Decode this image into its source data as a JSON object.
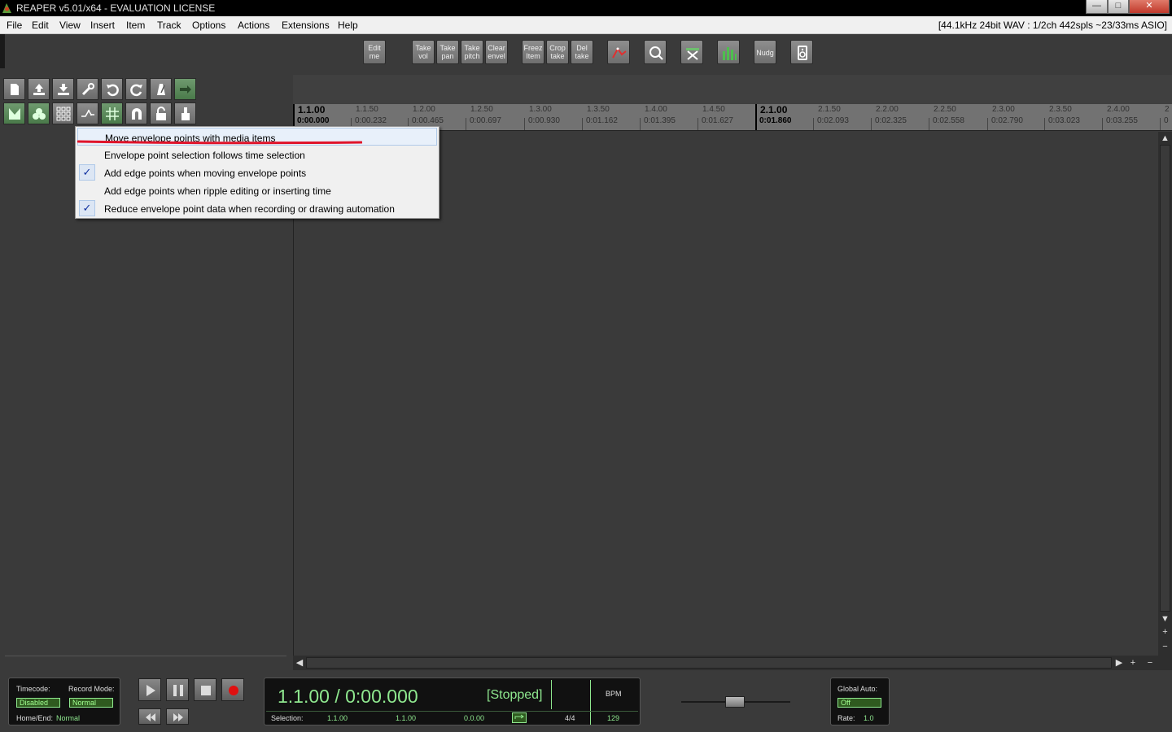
{
  "window": {
    "title": "REAPER v5.01/x64 - EVALUATION LICENSE",
    "controls": {
      "minimize": "—",
      "maximize": "□",
      "close": "✕"
    }
  },
  "menubar": {
    "items": [
      "File",
      "Edit",
      "View",
      "Insert",
      "Item",
      "Track",
      "Options",
      "Actions",
      "Extensions",
      "Help"
    ],
    "status": "[44.1kHz 24bit WAV : 1/2ch 442spls ~23/33ms ASIO]"
  },
  "toolbar": {
    "edit_mode": [
      "Edit",
      "me"
    ],
    "take_vol": [
      "Take",
      "vol"
    ],
    "take_pan": [
      "Take",
      "pan"
    ],
    "take_pitch": [
      "Take",
      "pitch"
    ],
    "clear_envel": [
      "Clear",
      "envel"
    ],
    "freeze_item": [
      "Freez",
      "Item"
    ],
    "crop_take": [
      "Crop",
      "take"
    ],
    "del_take": [
      "Del",
      "take"
    ],
    "nudge": "Nudg"
  },
  "ruler": {
    "marks": [
      {
        "beat": "1.1.00",
        "time": "0:00.000",
        "major": true
      },
      {
        "beat": "1.1.50",
        "time": "0:00.232"
      },
      {
        "beat": "1.2.00",
        "time": "0:00.465"
      },
      {
        "beat": "1.2.50",
        "time": "0:00.697"
      },
      {
        "beat": "1.3.00",
        "time": "0:00.930"
      },
      {
        "beat": "1.3.50",
        "time": "0:01.162"
      },
      {
        "beat": "1.4.00",
        "time": "0:01.395"
      },
      {
        "beat": "1.4.50",
        "time": "0:01.627"
      },
      {
        "beat": "2.1.00",
        "time": "0:01.860",
        "major": true
      },
      {
        "beat": "2.1.50",
        "time": "0:02.093"
      },
      {
        "beat": "2.2.00",
        "time": "0:02.325"
      },
      {
        "beat": "2.2.50",
        "time": "0:02.558"
      },
      {
        "beat": "2.3.00",
        "time": "0:02.790"
      },
      {
        "beat": "2.3.50",
        "time": "0:03.023"
      },
      {
        "beat": "2.4.00",
        "time": "0:03.255"
      },
      {
        "beat": "2",
        "time": "0"
      }
    ]
  },
  "context_menu": {
    "items": [
      {
        "label": "Move envelope points with media items",
        "checked": false,
        "highlighted": true
      },
      {
        "label": "Envelope point selection follows time selection",
        "checked": false
      },
      {
        "label": "Add edge points when moving envelope points",
        "checked": true
      },
      {
        "label": "Add edge points when ripple editing or inserting time",
        "checked": false
      },
      {
        "label": "Reduce envelope point data when recording or drawing automation",
        "checked": true
      }
    ],
    "check_glyph": "✓"
  },
  "transport": {
    "timecode_label": "Timecode:",
    "timecode_value": "Disabled",
    "record_mode_label": "Record Mode:",
    "record_mode_value": "Normal",
    "home_end_label": "Home/End:",
    "home_end_value": "Normal",
    "position": "1.1.00 / 0:00.000",
    "state": "[Stopped]",
    "bpm_label": "BPM",
    "selection_label": "Selection:",
    "sel_start": "1.1.00",
    "sel_end": "1.1.00",
    "sel_length": "0.0.00",
    "time_sig": "4/4",
    "bpm_value": "129",
    "global_auto_label": "Global Auto:",
    "global_auto_value": "Off",
    "rate_label": "Rate:",
    "rate_value": "1.0"
  },
  "scroll": {
    "up": "▲",
    "down": "▼",
    "left": "◀",
    "right": "▶",
    "plus": "+",
    "minus": "−"
  },
  "colors": {
    "accent_green": "#8fe88f",
    "record_red": "#e01010",
    "annotation_red": "#e0142a"
  }
}
